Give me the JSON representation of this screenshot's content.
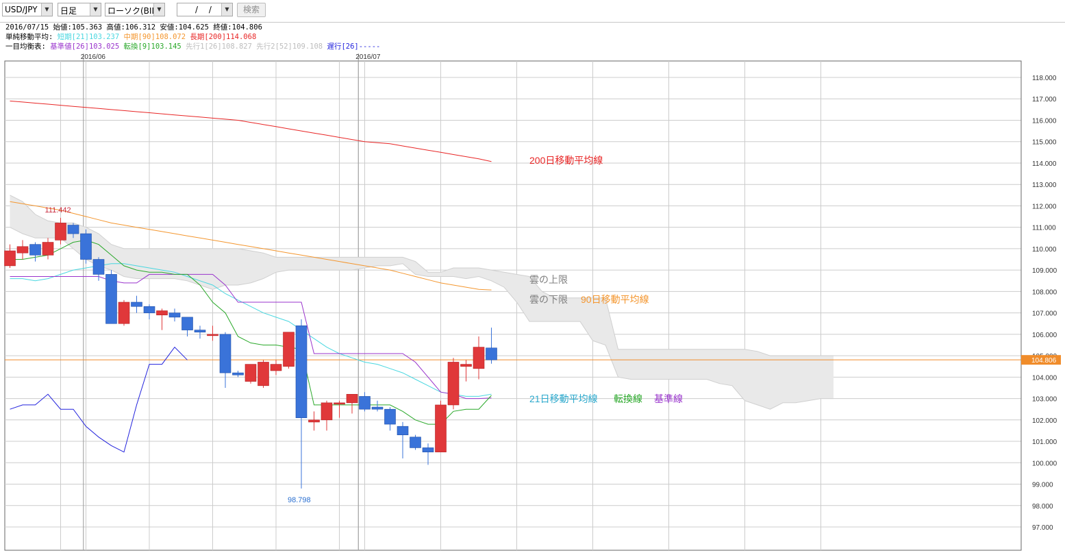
{
  "toolbar": {
    "pair": "USD/JPY",
    "period": "日足",
    "chart_kind": "ローソク(BID)",
    "date_value": "/ /",
    "search_label": "検索"
  },
  "info": {
    "ohlc": {
      "date": "2016/07/15",
      "open_label": "始値:",
      "open": "105.363",
      "high_label": "高値:",
      "high": "106.312",
      "low_label": "安値:",
      "low": "104.625",
      "close_label": "終値:",
      "close": "104.806"
    },
    "sma": {
      "label": "単純移動平均:",
      "short": "短期[21]103.237",
      "mid": "中期[90]108.072",
      "long": "長期[200]114.068"
    },
    "ichimoku": {
      "label": "一目均衡表:",
      "kijun": "基準値[26]103.025",
      "tenkan": "転換[9]103.145",
      "senkou1": "先行1[26]108.827",
      "senkou2": "先行2[52]109.108",
      "chikou": "遅行[26]-----"
    }
  },
  "colors": {
    "bull": "#e0383a",
    "bear": "#3a73d9",
    "sma21": "#49d7e0",
    "sma90": "#f4962e",
    "sma200": "#e82525",
    "tenkan": "#29a829",
    "kijun": "#9933cc",
    "chikou": "#2222dd",
    "cloud": "#e9e9e9",
    "price_line": "#f08c2a",
    "grid": "#cccccc"
  },
  "chart_data": {
    "type": "candlestick",
    "y_range": [
      97.0,
      118.0
    ],
    "y_tick_labels": [
      "97.000",
      "98.000",
      "99.000",
      "100.000",
      "101.000",
      "102.000",
      "103.000",
      "104.000",
      "105.000",
      "106.000",
      "107.000",
      "108.000",
      "109.000",
      "110.000",
      "111.000",
      "112.000",
      "113.000",
      "114.000",
      "115.000",
      "116.000",
      "117.000",
      "118.000"
    ],
    "x_month_labels": [
      {
        "label": "2016/06",
        "index": 5.8
      },
      {
        "label": "2016/07",
        "index": 27.5
      }
    ],
    "last_price": "104.806",
    "candles": [
      {
        "o": 109.2,
        "h": 110.2,
        "l": 109.1,
        "c": 109.9
      },
      {
        "o": 109.8,
        "h": 110.4,
        "l": 109.5,
        "c": 110.1
      },
      {
        "o": 110.2,
        "h": 110.3,
        "l": 109.4,
        "c": 109.7
      },
      {
        "o": 109.7,
        "h": 110.5,
        "l": 109.5,
        "c": 110.3
      },
      {
        "o": 110.4,
        "h": 111.442,
        "l": 110.2,
        "c": 111.2
      },
      {
        "o": 111.1,
        "h": 111.2,
        "l": 110.5,
        "c": 110.7
      },
      {
        "o": 110.7,
        "h": 110.9,
        "l": 109.3,
        "c": 109.5
      },
      {
        "o": 109.5,
        "h": 109.6,
        "l": 108.5,
        "c": 108.8
      },
      {
        "o": 108.8,
        "h": 109.0,
        "l": 106.5,
        "c": 106.5
      },
      {
        "o": 106.5,
        "h": 107.6,
        "l": 106.4,
        "c": 107.5
      },
      {
        "o": 107.5,
        "h": 107.8,
        "l": 107.0,
        "c": 107.3
      },
      {
        "o": 107.3,
        "h": 107.4,
        "l": 106.7,
        "c": 107.0
      },
      {
        "o": 106.9,
        "h": 107.2,
        "l": 106.2,
        "c": 107.1
      },
      {
        "o": 107.0,
        "h": 107.2,
        "l": 106.6,
        "c": 106.8
      },
      {
        "o": 106.8,
        "h": 106.8,
        "l": 105.9,
        "c": 106.2
      },
      {
        "o": 106.2,
        "h": 106.4,
        "l": 105.8,
        "c": 106.1
      },
      {
        "o": 106.0,
        "h": 106.4,
        "l": 105.7,
        "c": 106.0
      },
      {
        "o": 106.0,
        "h": 106.1,
        "l": 103.5,
        "c": 104.2
      },
      {
        "o": 104.2,
        "h": 104.3,
        "l": 104.0,
        "c": 104.1
      },
      {
        "o": 103.8,
        "h": 104.6,
        "l": 103.7,
        "c": 104.6
      },
      {
        "o": 103.6,
        "h": 104.8,
        "l": 103.5,
        "c": 104.7
      },
      {
        "o": 104.3,
        "h": 104.8,
        "l": 104.1,
        "c": 104.6
      },
      {
        "o": 104.5,
        "h": 106.1,
        "l": 104.4,
        "c": 106.1
      },
      {
        "o": 106.4,
        "h": 106.7,
        "l": 98.798,
        "c": 102.1
      },
      {
        "o": 101.9,
        "h": 102.4,
        "l": 101.5,
        "c": 102.0
      },
      {
        "o": 102.0,
        "h": 102.9,
        "l": 101.5,
        "c": 102.8
      },
      {
        "o": 102.8,
        "h": 102.9,
        "l": 102.1,
        "c": 102.8
      },
      {
        "o": 102.8,
        "h": 103.2,
        "l": 102.3,
        "c": 103.2
      },
      {
        "o": 103.1,
        "h": 103.3,
        "l": 102.4,
        "c": 102.5
      },
      {
        "o": 102.6,
        "h": 102.9,
        "l": 102.4,
        "c": 102.5
      },
      {
        "o": 102.5,
        "h": 102.6,
        "l": 101.5,
        "c": 101.8
      },
      {
        "o": 101.7,
        "h": 101.9,
        "l": 100.2,
        "c": 101.3
      },
      {
        "o": 101.2,
        "h": 101.3,
        "l": 100.6,
        "c": 100.7
      },
      {
        "o": 100.7,
        "h": 100.9,
        "l": 99.9,
        "c": 100.5
      },
      {
        "o": 100.5,
        "h": 102.9,
        "l": 100.5,
        "c": 102.7
      },
      {
        "o": 102.7,
        "h": 104.9,
        "l": 102.5,
        "c": 104.7
      },
      {
        "o": 104.5,
        "h": 104.8,
        "l": 103.8,
        "c": 104.6
      },
      {
        "o": 104.4,
        "h": 105.9,
        "l": 103.9,
        "c": 105.4
      },
      {
        "o": 105.363,
        "h": 106.312,
        "l": 104.625,
        "c": 104.806
      }
    ],
    "series": [
      {
        "name": "21日移動平均線",
        "key": "sma21",
        "values": [
          108.6,
          108.6,
          108.5,
          108.6,
          108.8,
          109.0,
          109.1,
          109.2,
          109.3,
          109.3,
          109.2,
          109.1,
          109.0,
          108.9,
          108.7,
          108.5,
          108.3,
          107.9,
          107.6,
          107.3,
          107.0,
          106.8,
          106.6,
          106.2,
          105.8,
          105.4,
          105.1,
          104.9,
          104.7,
          104.6,
          104.4,
          104.2,
          103.9,
          103.6,
          103.3,
          103.2,
          103.1,
          103.1,
          103.2
        ]
      },
      {
        "name": "90日移動平均線",
        "key": "sma90",
        "values": [
          112.2,
          112.1,
          112.0,
          111.9,
          111.8,
          111.65,
          111.5,
          111.35,
          111.2,
          111.1,
          111.0,
          110.9,
          110.8,
          110.7,
          110.6,
          110.5,
          110.4,
          110.3,
          110.2,
          110.1,
          110.0,
          109.9,
          109.8,
          109.7,
          109.6,
          109.5,
          109.4,
          109.3,
          109.2,
          109.1,
          109.0,
          108.85,
          108.7,
          108.55,
          108.4,
          108.3,
          108.2,
          108.1,
          108.072
        ]
      },
      {
        "name": "200日移動平均線",
        "key": "sma200",
        "values": [
          116.9,
          116.85,
          116.8,
          116.75,
          116.7,
          116.65,
          116.6,
          116.55,
          116.5,
          116.45,
          116.4,
          116.35,
          116.3,
          116.25,
          116.2,
          116.15,
          116.1,
          116.05,
          116.0,
          115.9,
          115.8,
          115.7,
          115.6,
          115.5,
          115.4,
          115.3,
          115.2,
          115.1,
          115.0,
          114.95,
          114.9,
          114.8,
          114.7,
          114.6,
          114.5,
          114.4,
          114.3,
          114.2,
          114.068
        ]
      },
      {
        "name": "転換線",
        "key": "tenkan",
        "values": [
          109.5,
          109.5,
          109.6,
          109.7,
          110.0,
          110.3,
          110.4,
          110.2,
          109.7,
          109.2,
          109.0,
          108.9,
          108.9,
          108.8,
          108.8,
          108.3,
          107.5,
          107.0,
          105.9,
          105.6,
          105.5,
          105.5,
          105.4,
          105.3,
          102.7,
          102.7,
          102.7,
          102.7,
          102.7,
          102.7,
          102.7,
          102.4,
          102.0,
          101.8,
          101.8,
          102.4,
          102.5,
          102.5,
          103.145
        ]
      },
      {
        "name": "基準線",
        "key": "kijun",
        "values": [
          108.7,
          108.7,
          108.7,
          108.7,
          108.7,
          108.7,
          108.7,
          108.7,
          108.5,
          108.4,
          108.4,
          108.8,
          108.8,
          108.8,
          108.8,
          108.8,
          108.8,
          108.3,
          107.5,
          107.5,
          107.5,
          107.5,
          107.5,
          107.5,
          105.1,
          105.1,
          105.1,
          105.1,
          105.1,
          105.1,
          105.1,
          105.1,
          104.7,
          104.0,
          103.3,
          103.2,
          103.0,
          103.0,
          103.025
        ]
      },
      {
        "name": "遅行線",
        "key": "chikou",
        "values": [
          102.5,
          102.7,
          102.7,
          103.2,
          102.5,
          102.5,
          101.7,
          101.2,
          100.8,
          100.5,
          102.7,
          104.6,
          104.6,
          105.4,
          104.8
        ]
      },
      {
        "name": "雲の上限",
        "key": "cloud_upper",
        "values": [
          112.5,
          112.2,
          111.6,
          111.3,
          111.2,
          111.2,
          111.0,
          110.7,
          110.2,
          110.0,
          110.0,
          110.0,
          110.0,
          110.0,
          110.0,
          110.0,
          110.0,
          110.0,
          110.0,
          109.9,
          109.8,
          109.6,
          109.6,
          109.6,
          109.6,
          109.6,
          109.6,
          109.6,
          109.6,
          109.6,
          109.6,
          109.6,
          109.4,
          108.9,
          108.9,
          109.1,
          109.1,
          109.1,
          109.0,
          108.9,
          108.8,
          108.7,
          108.0,
          107.7,
          107.7,
          107.7,
          107.7,
          107.7,
          105.3,
          105.3,
          105.3,
          105.3,
          105.3,
          105.3,
          105.3,
          105.3,
          105.3,
          105.3,
          105.3,
          105.2,
          105.0,
          105.0,
          105.0,
          105.0,
          105.0,
          105.0
        ]
      },
      {
        "name": "雲の下限",
        "key": "cloud_lower",
        "values": [
          111.0,
          110.7,
          110.5,
          110.5,
          110.5,
          110.0,
          109.5,
          109.2,
          109.0,
          108.7,
          108.6,
          108.6,
          108.6,
          108.6,
          108.5,
          108.3,
          108.1,
          108.3,
          108.3,
          108.4,
          108.6,
          108.9,
          109.0,
          109.0,
          109.0,
          109.0,
          109.0,
          109.0,
          109.1,
          109.2,
          109.2,
          109.3,
          108.8,
          108.7,
          108.7,
          108.7,
          108.6,
          108.7,
          108.5,
          108.2,
          107.5,
          106.6,
          106.6,
          106.6,
          106.6,
          106.6,
          105.7,
          105.5,
          104.0,
          103.9,
          103.9,
          103.9,
          103.9,
          103.9,
          103.9,
          103.9,
          103.7,
          103.6,
          102.9,
          102.7,
          102.5,
          102.8,
          102.8,
          102.9,
          103.0,
          103.0
        ]
      }
    ],
    "annotations": {
      "high_marker": "111.442",
      "low_marker": "98.798",
      "label_sma200": "200日移動平均線",
      "label_cloud_upper": "雲の上限",
      "label_cloud_lower": "雲の下限",
      "label_sma90": "90日移動平均線",
      "label_sma21": "21日移動平均線",
      "label_tenkan": "転換線",
      "label_kijun": "基準線"
    }
  }
}
